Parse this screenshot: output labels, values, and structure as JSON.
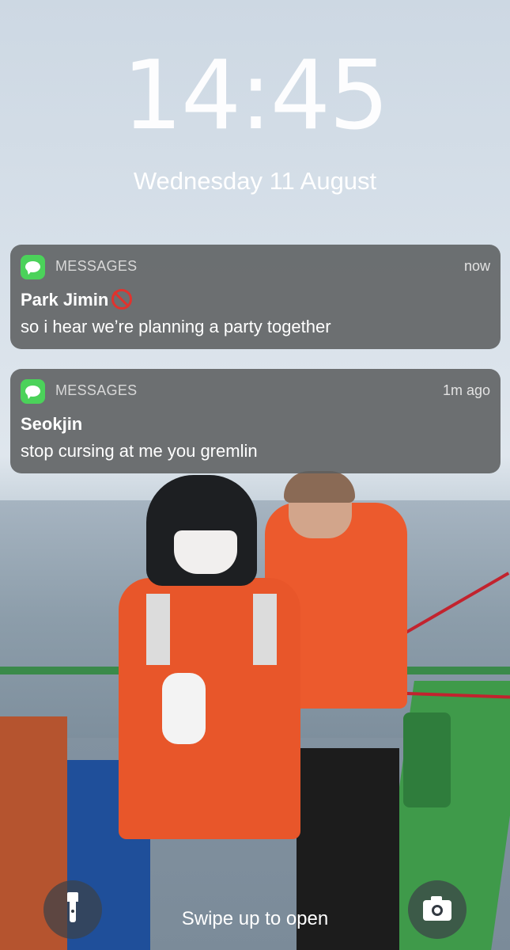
{
  "lockscreen": {
    "time": "14:45",
    "date": "Wednesday 11 August",
    "swipe_hint": "Swipe up to open"
  },
  "notifications": [
    {
      "app": "MESSAGES",
      "time": "now",
      "sender": "Park Jimin",
      "sender_emoji": "no-entry-emoji",
      "body": "so i hear we’re planning a party together"
    },
    {
      "app": "MESSAGES",
      "time": "1m ago",
      "sender": "Seokjin",
      "body": "stop cursing at me you gremlin"
    }
  ],
  "controls": {
    "left_icon": "flashlight-icon",
    "right_icon": "camera-icon"
  },
  "colors": {
    "messages_app_green": "#4bd25a",
    "notification_bg": "#5c5e60"
  }
}
